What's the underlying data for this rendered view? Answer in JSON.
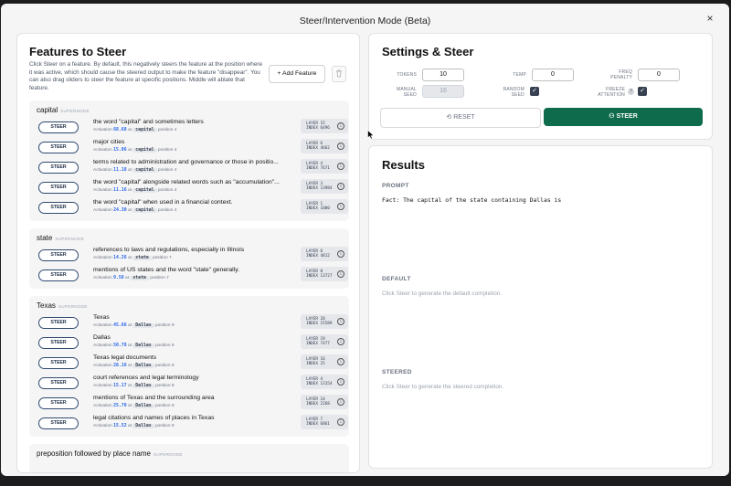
{
  "modal": {
    "title": "Steer/Intervention Mode (Beta)",
    "close": "×"
  },
  "left": {
    "title": "Features to Steer",
    "description": "Click Steer on a feature. By default, this negatively steers the feature at the position where it was active, which should cause the steered output to make the feature \"disappear\". You can also drag sliders to steer the feature at specific positions. Middle will ablate that feature.",
    "add_feature": "+ Add Feature",
    "supernode_tag": "SUPERNODE",
    "steer_label": "STEER",
    "activation_label": "Activation",
    "at_label": "at",
    "position_label": "position",
    "groups": [
      {
        "name": "capital",
        "features": [
          {
            "label": "the word \"capital\" and sometimes letters",
            "activation": "68.68",
            "token": "capital",
            "position": "4",
            "layer": "LAYER 15",
            "index": "INDEX 6496"
          },
          {
            "label": "major cities",
            "activation": "15.06",
            "token": "capital",
            "position": "4",
            "layer": "LAYER 6",
            "index": "INDEX 4662"
          },
          {
            "label": "terms related to administration and governance or those in positio...",
            "activation": "11.18",
            "token": "capital",
            "position": "4",
            "layer": "LAYER 4",
            "index": "INDEX 7671"
          },
          {
            "label": "the word \"capital\" alongside related words such as \"accumulation\"...",
            "activation": "11.16",
            "token": "capital",
            "position": "4",
            "layer": "LAYER 3",
            "index": "INDEX 13984"
          },
          {
            "label": "the word \"capital\" when used in a financial context.",
            "activation": "24.30",
            "token": "capital",
            "position": "4",
            "layer": "LAYER 1",
            "index": "INDEX 1000"
          }
        ]
      },
      {
        "name": "state",
        "features": [
          {
            "label": "references to laws and regulations, especially in Illinois",
            "activation": "14.26",
            "token": "state",
            "position": "7",
            "layer": "LAYER 6",
            "index": "INDEX 4812"
          },
          {
            "label": "mentions of US states and the word \"state\" generally.",
            "activation": "9.58",
            "token": "state",
            "position": "7",
            "layer": "LAYER 0",
            "index": "INDEX 13727"
          }
        ]
      },
      {
        "name": "Texas",
        "features": [
          {
            "label": "Texas",
            "activation": "45.66",
            "token": "Dallas",
            "position": "9",
            "layer": "LAYER 20",
            "index": "INDEX 15589"
          },
          {
            "label": "Dallas",
            "activation": "50.78",
            "token": "Dallas",
            "position": "9",
            "layer": "LAYER 19",
            "index": "INDEX 7477"
          },
          {
            "label": "Texas legal documents",
            "activation": "28.16",
            "token": "Dallas",
            "position": "9",
            "layer": "LAYER 16",
            "index": "INDEX 25"
          },
          {
            "label": "court references and legal terminology",
            "activation": "15.17",
            "token": "Dallas",
            "position": "9",
            "layer": "LAYER 4",
            "index": "INDEX 13154"
          },
          {
            "label": "mentions of Texas and the surrounding area",
            "activation": "25.70",
            "token": "Dallas",
            "position": "9",
            "layer": "LAYER 14",
            "index": "INDEX 2268"
          },
          {
            "label": "legal citations and names of places in Texas",
            "activation": "15.52",
            "token": "Dallas",
            "position": "9",
            "layer": "LAYER 7",
            "index": "INDEX 6861"
          }
        ]
      },
      {
        "name": "preposition followed by place name",
        "features": []
      }
    ]
  },
  "settings": {
    "title": "Settings & Steer",
    "tokens_label": "TOKENS",
    "tokens": "10",
    "temp_label": "TEMP",
    "temp": "0",
    "freq_label": "FREQ PENALTY",
    "freq": "0",
    "seed_label": "MANUAL SEED",
    "seed": "16",
    "random_seed_label": "RANDOM SEED",
    "random_seed": true,
    "freeze_label": "FREEZE ATTENTION",
    "freeze": true,
    "reset": "RESET",
    "steer": "STEER"
  },
  "results": {
    "title": "Results",
    "prompt_label": "PROMPT",
    "prompt": "Fact: The capital of the state containing Dallas is",
    "default_label": "DEFAULT",
    "default_hint": "Click Steer to generate the default completion.",
    "steered_label": "STEERED",
    "steered_hint": "Click Steer to generate the steered completion."
  },
  "colors": {
    "steer_green": "#0e6b4c",
    "activation_blue": "#2563eb"
  }
}
